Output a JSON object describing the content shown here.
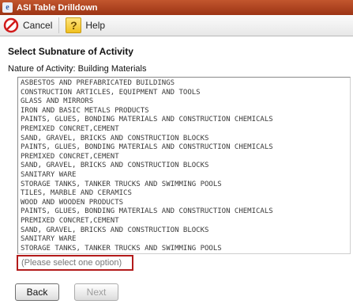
{
  "window": {
    "title": "ASI Table Drilldown"
  },
  "toolbar": {
    "cancel_label": "Cancel",
    "help_label": "Help"
  },
  "page": {
    "title": "Select Subnature of Activity",
    "nature_of_activity": "Nature of Activity: Building Materials"
  },
  "list": {
    "items": [
      "ASBESTOS AND PREFABRICATED BUILDINGS",
      "CONSTRUCTION ARTICLES, EQUIPMENT AND TOOLS",
      "GLASS AND MIRRORS",
      "IRON AND BASIC METALS PRODUCTS",
      "PAINTS, GLUES, BONDING MATERIALS AND CONSTRUCTION CHEMICALS",
      "PREMIXED CONCRET,CEMENT",
      "SAND, GRAVEL, BRICKS AND CONSTRUCTION BLOCKS",
      "PAINTS, GLUES, BONDING MATERIALS AND CONSTRUCTION CHEMICALS",
      "PREMIXED CONCRET,CEMENT",
      "SAND, GRAVEL, BRICKS AND CONSTRUCTION BLOCKS",
      "SANITARY WARE",
      "STORAGE TANKS, TANKER TRUCKS AND SWIMMING POOLS",
      "TILES, MARBLE AND CERAMICS",
      "WOOD AND WOODEN PRODUCTS",
      "PAINTS, GLUES, BONDING MATERIALS AND CONSTRUCTION CHEMICALS",
      "PREMIXED CONCRET,CEMENT",
      "SAND, GRAVEL, BRICKS AND CONSTRUCTION BLOCKS",
      "SANITARY WARE",
      "STORAGE TANKS, TANKER TRUCKS AND SWIMMING POOLS"
    ]
  },
  "validation": {
    "message": "(Please select one option)"
  },
  "buttons": {
    "back_label": "Back",
    "next_label": "Next"
  },
  "icons": {
    "app": "app-icon",
    "cancel": "cancel-icon",
    "help": "help-icon"
  },
  "colors": {
    "titlebar": "#b2441f",
    "warning_border": "#b31b1b"
  }
}
